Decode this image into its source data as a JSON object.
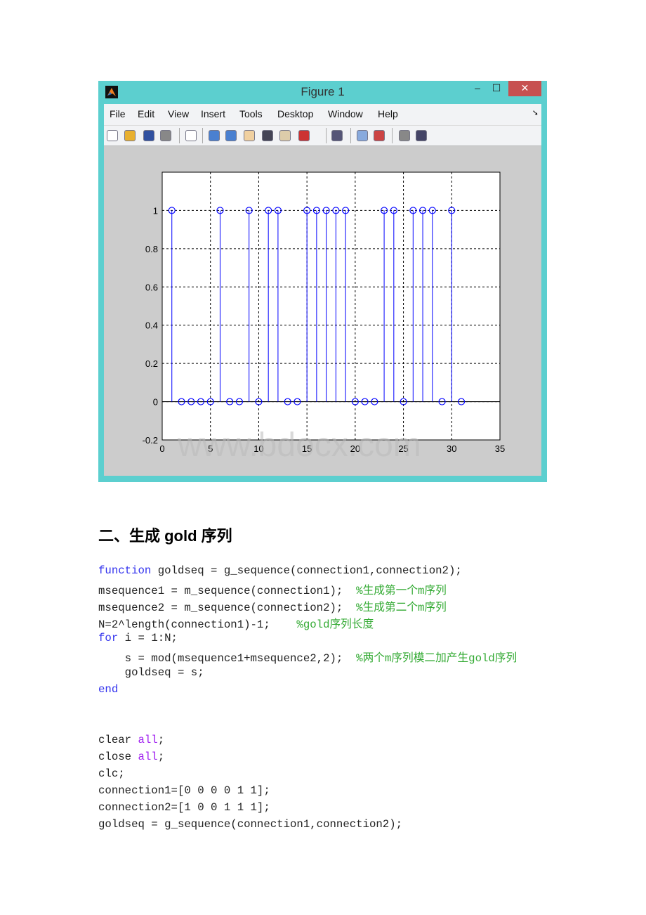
{
  "figure_window": {
    "title": "Figure 1",
    "controls": {
      "minimize": "–",
      "maximize": "☐",
      "close": "✕"
    },
    "close_color": "#c75050",
    "frame_color": "#5ccfcf",
    "menu": [
      "File",
      "Edit",
      "View",
      "Insert",
      "Tools",
      "Desktop",
      "Window",
      "Help"
    ],
    "menu_arrow": "➘",
    "toolbar_icons": [
      "new-figure-icon",
      "open-file-icon",
      "save-icon",
      "print-icon",
      "edit-plot-arrow-icon",
      "zoom-in-icon",
      "zoom-out-icon",
      "pan-hand-icon",
      "rotate-3d-icon",
      "data-cursor-icon",
      "brush-icon",
      "link-plot-icon",
      "colorbar-icon",
      "legend-icon",
      "hide-plot-tools-icon",
      "show-plot-tools-icon"
    ]
  },
  "chart_data": {
    "type": "stem",
    "x": [
      1,
      2,
      3,
      4,
      5,
      6,
      7,
      8,
      9,
      10,
      11,
      12,
      13,
      14,
      15,
      16,
      17,
      18,
      19,
      20,
      21,
      22,
      23,
      24,
      25,
      26,
      27,
      28,
      29,
      30,
      31
    ],
    "values": [
      1,
      0,
      0,
      0,
      0,
      1,
      0,
      0,
      1,
      0,
      1,
      1,
      0,
      0,
      1,
      1,
      1,
      1,
      1,
      0,
      0,
      0,
      1,
      1,
      0,
      1,
      1,
      1,
      0,
      1,
      0
    ],
    "xlim": [
      0,
      35
    ],
    "ylim": [
      -0.2,
      1.2
    ],
    "xticks": [
      "0",
      "5",
      "10",
      "15",
      "20",
      "25",
      "30",
      "35"
    ],
    "yticks": [
      "-0.2",
      "0",
      "0.2",
      "0.4",
      "0.6",
      "0.8",
      "1"
    ],
    "grid": true,
    "marker": "circle",
    "color": "#0000ff",
    "title": "",
    "xlabel": "",
    "ylabel": ""
  },
  "watermark": "www.bdocx.com",
  "heading": "二、生成 gold 序列",
  "code_blocks": [
    [
      [
        [
          "kw",
          "function"
        ],
        [
          "p",
          " goldseq = g_sequence(connection1,connection2);"
        ]
      ],
      [
        [
          "p",
          "msequence1 = m_sequence(connection1);  "
        ],
        [
          "cm",
          "%生成第一个m序列"
        ]
      ],
      [
        [
          "p",
          "msequence2 = m_sequence(connection2);  "
        ],
        [
          "cm",
          "%生成第二个m序列"
        ]
      ],
      [
        [
          "p",
          "N=2^length(connection1)-1;    "
        ],
        [
          "cm",
          "%gold序列长度"
        ]
      ],
      [
        [
          "kw",
          "for"
        ],
        [
          "p",
          " i = 1:N;"
        ]
      ],
      [
        [
          "p",
          "    s = mod(msequence1+msequence2,2);  "
        ],
        [
          "cm",
          "%两个m序列模二加产生gold序列"
        ]
      ],
      [
        [
          "p",
          "    goldseq = s;"
        ]
      ],
      [
        [
          "kw",
          "end"
        ]
      ]
    ],
    [
      [
        [
          "p",
          "clear "
        ],
        [
          "st",
          "all"
        ],
        [
          "p",
          ";"
        ]
      ],
      [
        [
          "p",
          "close "
        ],
        [
          "st",
          "all"
        ],
        [
          "p",
          ";"
        ]
      ],
      [
        [
          "p",
          "clc;"
        ]
      ],
      [
        [
          "p",
          "connection1=[0 0 0 0 1 1];"
        ]
      ],
      [
        [
          "p",
          "connection2=[1 0 0 1 1 1];"
        ]
      ],
      [
        [
          "p",
          "goldseq = g_sequence(connection1,connection2);"
        ]
      ]
    ]
  ]
}
